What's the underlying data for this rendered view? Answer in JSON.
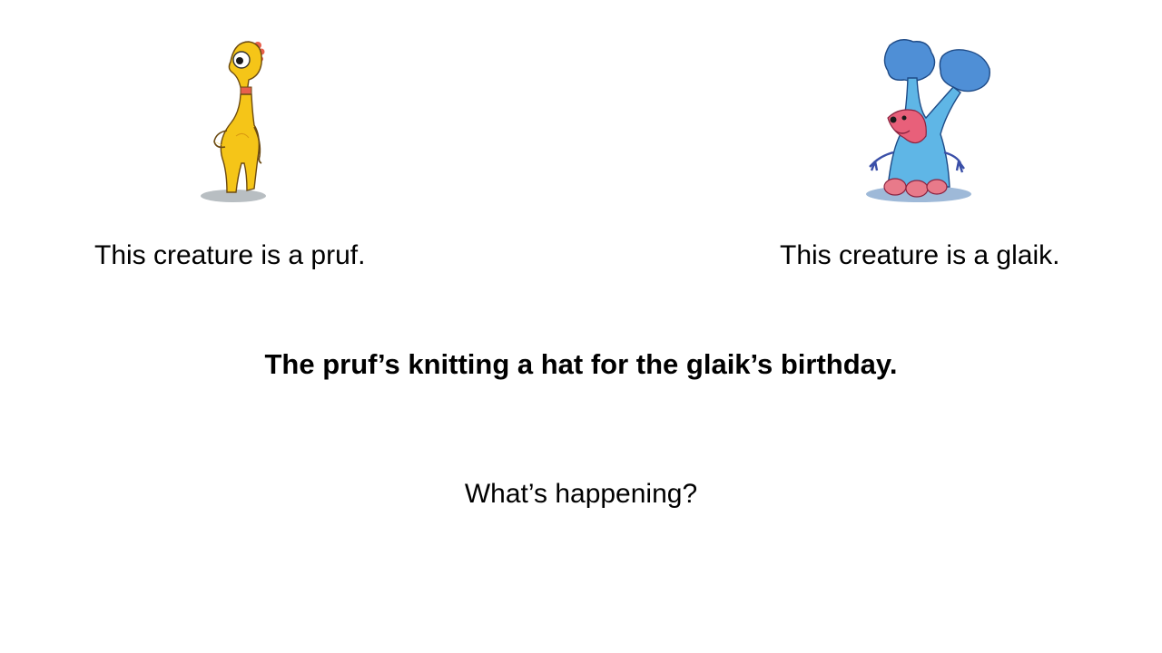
{
  "slide": {
    "left_caption": "This creature is a pruf.",
    "right_caption": "This creature is a glaik.",
    "sentence": "The pruf’s knitting a hat for the glaik’s birthday.",
    "question": "What’s happening?"
  },
  "illustrations": {
    "left": {
      "icon": "pruf-creature-illustration",
      "body_color": "#f5c518",
      "accent_color": "#e8604c"
    },
    "right": {
      "icon": "glaik-creature-illustration",
      "body_color": "#5fb6e6",
      "accent_color": "#e8607a"
    }
  }
}
